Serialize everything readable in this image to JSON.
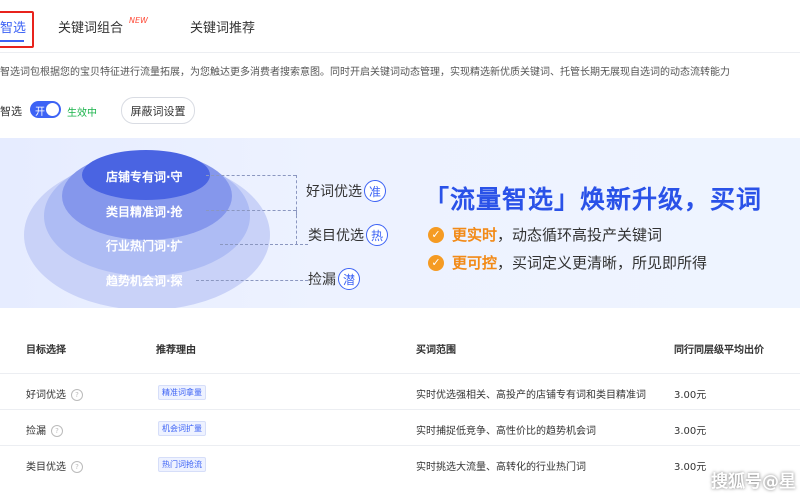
{
  "tabs": [
    {
      "label": "智选",
      "active": true
    },
    {
      "label": "关键词组合",
      "badge": "NEW"
    },
    {
      "label": "关键词推荐"
    }
  ],
  "description": "智选词包根据您的宝贝特征进行流量拓展，为您触达更多消费者搜索意图。同时开启关键词动态管理，实现精选新优质关键词、托管长期无展现自选词的动态流转能力",
  "controls": {
    "label": "智选",
    "toggle_text": "开",
    "status": "生效中",
    "shield_button": "屏蔽词设置"
  },
  "banner": {
    "rings": [
      "店铺专有词·守",
      "类目精准词·抢",
      "行业热门词·扩",
      "趋势机会词·探"
    ],
    "tiers": [
      {
        "label": "好词优选",
        "badge": "准"
      },
      {
        "label": "类目优选",
        "badge": "热"
      },
      {
        "label": "捡漏",
        "badge": "潜"
      }
    ],
    "headline": "「流量智选」焕新升级，买词",
    "bullets": [
      {
        "highlight": "更实时",
        "text": "，动态循环高投产关键词"
      },
      {
        "highlight": "更可控",
        "text": "，买词定义更清晰，所见即所得"
      }
    ],
    "colors": {
      "primary": "#2a52e8",
      "accent": "#f59b23"
    }
  },
  "table": {
    "headers": [
      "目标选择",
      "推荐理由",
      "买词范围",
      "同行同层级平均出价"
    ],
    "rows": [
      {
        "target": "好词优选",
        "reason": "精准词拿量",
        "scope": "实时优选强相关、高投产的店铺专有词和类目精准词",
        "price": "3.00元"
      },
      {
        "target": "捡漏",
        "reason": "机会词扩量",
        "scope": "实时捕捉低竞争、高性价比的趋势机会词",
        "price": "3.00元"
      },
      {
        "target": "类目优选",
        "reason": "热门词抢流",
        "scope": "实时挑选大流量、高转化的行业热门词",
        "price": "3.00元"
      }
    ]
  },
  "watermark": "搜狐号@星"
}
